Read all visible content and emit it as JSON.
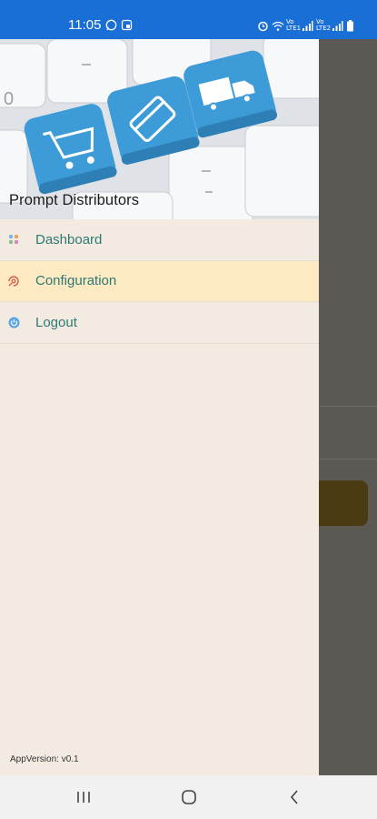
{
  "status_bar": {
    "time": "11:05",
    "left_icons": [
      "whatsapp-icon",
      "message-icon"
    ],
    "right_icons": [
      "alarm-icon",
      "wifi-icon",
      "signal-icon",
      "signal-icon",
      "battery-icon"
    ],
    "volte_label_1": "Vo LTE1",
    "volte_label_2": "Vo LTE2"
  },
  "drawer": {
    "header_title": "Prompt Distributors",
    "menu": [
      {
        "label": "Dashboard",
        "icon": "dashboard-icon",
        "selected": false
      },
      {
        "label": "Configuration",
        "icon": "settings-icon",
        "selected": true
      },
      {
        "label": "Logout",
        "icon": "power-icon",
        "selected": false
      }
    ],
    "app_version": "AppVersion: v0.1"
  },
  "nav_bar": {
    "buttons": [
      "recent-apps-icon",
      "home-icon",
      "back-icon"
    ]
  },
  "colors": {
    "status_bar": "#1a6fd6",
    "drawer_bg": "#f3ebe1",
    "selected_bg": "#fde9c2",
    "menu_text": "#2d7a73",
    "scrim": "#5b5954"
  }
}
